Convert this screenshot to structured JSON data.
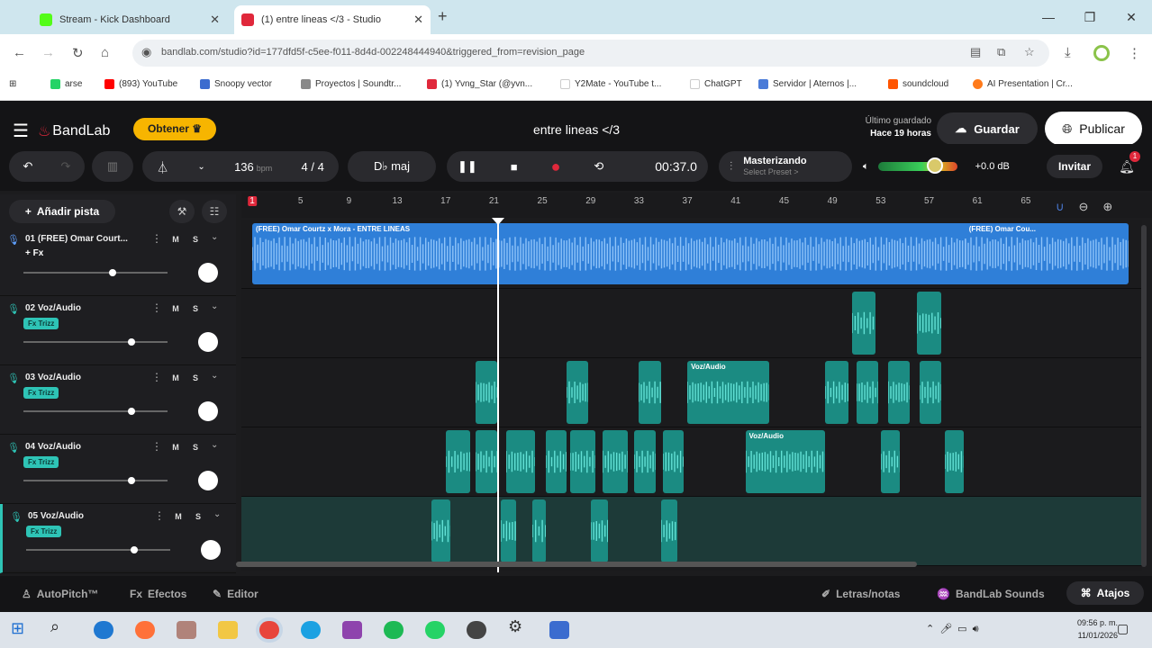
{
  "browser": {
    "tabs": [
      {
        "title": "Stream - Kick Dashboard",
        "favicon_color": "#53fc18"
      },
      {
        "title": "(1) entre lineas </3 - Studio",
        "favicon_color": "#e0283b"
      }
    ],
    "url": "bandlab.com/studio?id=177dfd5f-c5ee-f011-8d4d-002248444940&triggered_from=revision_page",
    "bookmarks": [
      {
        "label": "arse",
        "color": "#25d366"
      },
      {
        "label": "(893) YouTube",
        "color": "#ff0000"
      },
      {
        "label": "Snoopy vector",
        "color": "#3b6ccf"
      },
      {
        "label": "Proyectos | Soundtr...",
        "color": "#888888"
      },
      {
        "label": "(1) Yvng_Star (@yvn...",
        "color": "#e0283b"
      },
      {
        "label": "Y2Mate - YouTube t...",
        "color": "#ffffff"
      },
      {
        "label": "ChatGPT",
        "color": "#ffffff"
      },
      {
        "label": "Servidor | Aternos |...",
        "color": "#4a7bd8"
      },
      {
        "label": "soundcloud",
        "color": "#ff5500"
      },
      {
        "label": "AI Presentation | Cr...",
        "color": "#ff7a1a"
      }
    ]
  },
  "app": {
    "logo": "BandLab",
    "obtener": "Obtener",
    "project_title": "entre lineas </3",
    "saved_label": "Último guardado",
    "saved_time": "Hace 19 horas",
    "guardar": "Guardar",
    "publicar": "Publicar",
    "bpm": "136",
    "bpm_unit": "bpm",
    "time_sig": "4 / 4",
    "key": "D♭ maj",
    "time": "00:37.0",
    "master_title": "Masterizando",
    "master_sub": "Select Preset >",
    "volume_db": "+0.0 dB",
    "invitar": "Invitar",
    "notifications": "1",
    "add_track": "Añadir pista",
    "playhead_bar": 21.3,
    "master_volume_level": 0.72,
    "ruler_bars": [
      "1",
      "5",
      "9",
      "13",
      "17",
      "21",
      "25",
      "29",
      "33",
      "37",
      "41",
      "45",
      "49",
      "53",
      "57",
      "61",
      "65"
    ]
  },
  "tracks": [
    {
      "name": "01 (FREE) Omar Court...",
      "fx": "+ Fx",
      "fx_active": false,
      "volume": 0.62,
      "color": "#5fa0ff",
      "clips": [
        {
          "label": "(FREE) Omar Courtz x Mora - ENTRE LINEAS",
          "start": 1.0,
          "end": 65.6
        },
        {
          "label": "(FREE) Omar Cou...",
          "start": 60.0,
          "end": 73.5
        }
      ]
    },
    {
      "name": "02 Voz/Audio",
      "fx": "Fx Trizz",
      "fx_active": true,
      "volume": 0.75,
      "color": "#2ec4b6",
      "clips": [
        {
          "label": "",
          "start": 50.6,
          "end": 52.6
        },
        {
          "label": "",
          "start": 56.0,
          "end": 58.0
        }
      ]
    },
    {
      "name": "03 Voz/Audio",
      "fx": "Fx Trizz",
      "fx_active": true,
      "volume": 0.75,
      "color": "#2ec4b6",
      "clips": [
        {
          "label": "",
          "start": 19.5,
          "end": 21.3
        },
        {
          "label": "",
          "start": 27.0,
          "end": 28.8
        },
        {
          "label": "",
          "start": 33.0,
          "end": 34.8
        },
        {
          "label": "Voz/Audio",
          "start": 37.0,
          "end": 43.8
        },
        {
          "label": "",
          "start": 48.4,
          "end": 50.3
        },
        {
          "label": "",
          "start": 51.0,
          "end": 52.8
        },
        {
          "label": "",
          "start": 53.6,
          "end": 55.4
        },
        {
          "label": "",
          "start": 56.2,
          "end": 58.0
        }
      ]
    },
    {
      "name": "04 Voz/Audio",
      "fx": "Fx Trizz",
      "fx_active": true,
      "volume": 0.75,
      "color": "#2ec4b6",
      "clips": [
        {
          "label": "",
          "start": 17.0,
          "end": 19.0
        },
        {
          "label": "",
          "start": 19.5,
          "end": 21.3
        },
        {
          "label": "",
          "start": 22.0,
          "end": 24.4
        },
        {
          "label": "",
          "start": 25.3,
          "end": 27.0
        },
        {
          "label": "",
          "start": 27.3,
          "end": 29.4
        },
        {
          "label": "",
          "start": 30.0,
          "end": 32.1
        },
        {
          "label": "",
          "start": 32.6,
          "end": 34.4
        },
        {
          "label": "",
          "start": 35.0,
          "end": 36.7
        },
        {
          "label": "Voz/Audio",
          "start": 41.8,
          "end": 48.4
        },
        {
          "label": "",
          "start": 53.0,
          "end": 54.6
        },
        {
          "label": "",
          "start": 58.3,
          "end": 59.9
        }
      ]
    },
    {
      "name": "05 Voz/Audio",
      "fx": "Fx Trizz",
      "fx_active": true,
      "volume": 0.75,
      "color": "#2ec4b6",
      "clips": [
        {
          "label": "",
          "start": 15.8,
          "end": 17.4
        },
        {
          "label": "",
          "start": 21.6,
          "end": 22.8
        },
        {
          "label": "",
          "start": 24.2,
          "end": 25.3
        },
        {
          "label": "",
          "start": 29.0,
          "end": 30.4
        },
        {
          "label": "",
          "start": 34.8,
          "end": 36.2
        }
      ]
    }
  ],
  "bottom": {
    "autopitch": "AutoPitch™",
    "efectos": "Efectos",
    "editor": "Editor",
    "letras": "Letras/notas",
    "sounds": "BandLab Sounds",
    "atajos": "Atajos"
  },
  "taskbar": {
    "time": "09:56 p. m.",
    "date": "11/01/2026"
  }
}
